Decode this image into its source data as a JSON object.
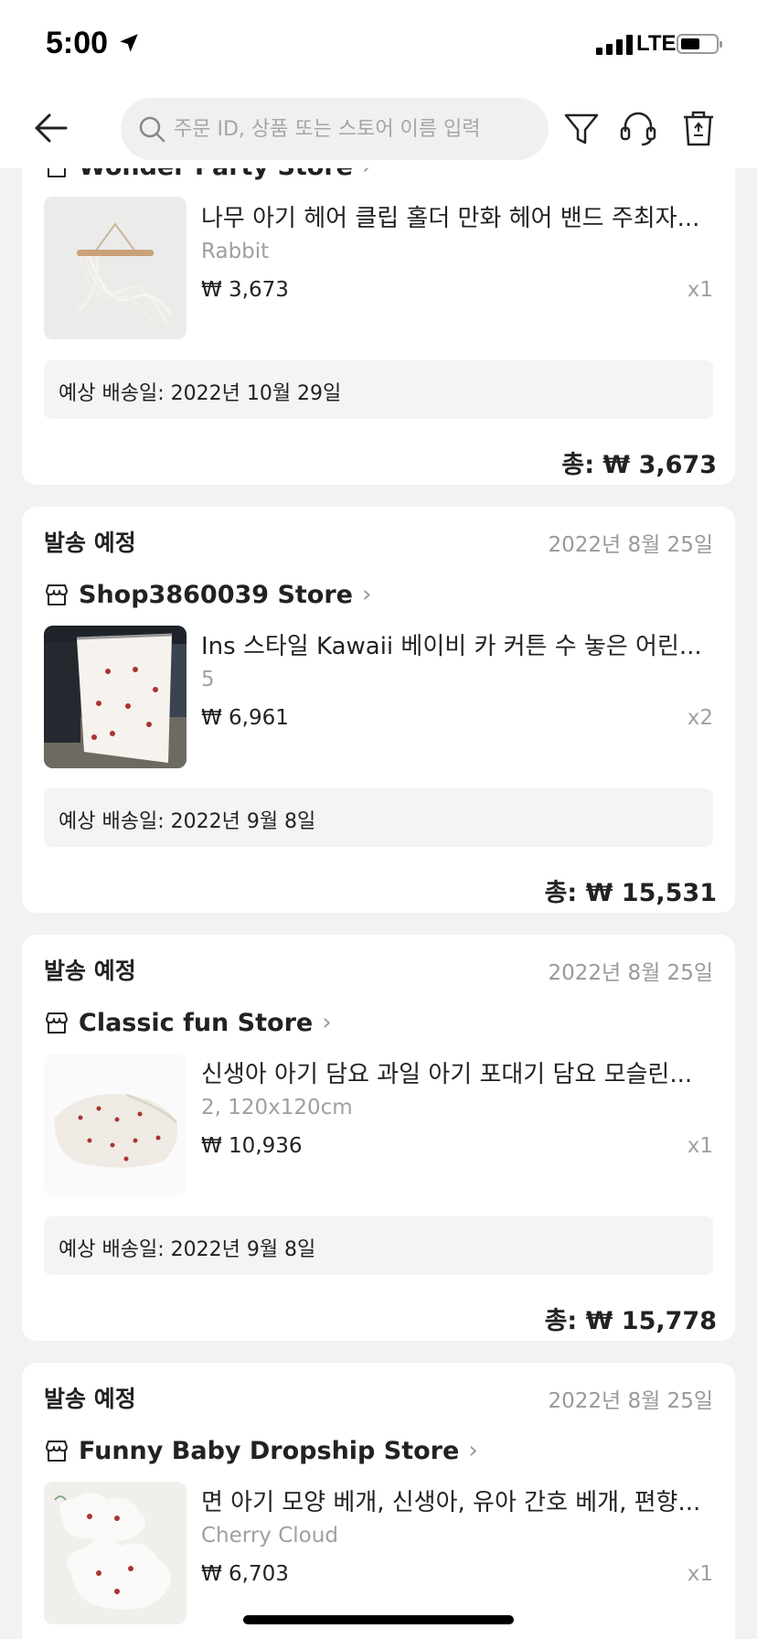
{
  "status_bar": {
    "time": "5:00",
    "network": "LTE"
  },
  "search": {
    "placeholder": "주문 ID, 상품 또는 스토어 이름 입력"
  },
  "orders": [
    {
      "store": "Wonder Party Store",
      "product_title": "나무 아기 헤어 클립 홀더 만화 헤어 밴드 주최자...",
      "variant": "Rabbit",
      "price": "₩ 3,673",
      "quantity": "x1",
      "eta": "예상 배송일: 2022년 10월 29일",
      "total": "총: ₩ 3,673"
    },
    {
      "status": "발송 예정",
      "date": "2022년 8월 25일",
      "store": "Shop3860039 Store",
      "product_title": "Ins 스타일 Kawaii 베이비 카 커튼 수 놓은 어린...",
      "variant": "5",
      "price": "₩ 6,961",
      "quantity": "x2",
      "eta": "예상 배송일: 2022년 9월 8일",
      "total": "총: ₩ 15,531"
    },
    {
      "status": "발송 예정",
      "date": "2022년 8월 25일",
      "store": "Classic fun Store",
      "product_title": "신생아 아기 담요 과일 아기 포대기 담요 모슬린...",
      "variant": "2, 120x120cm",
      "price": "₩ 10,936",
      "quantity": "x1",
      "eta": "예상 배송일: 2022년 9월 8일",
      "total": "총: ₩ 15,778"
    },
    {
      "status": "발송 예정",
      "date": "2022년 8월 25일",
      "store": "Funny Baby Dropship Store",
      "product_title": "면 아기 모양 베개, 신생아, 유아 간호 베개, 편향...",
      "variant": "Cherry Cloud",
      "price": "₩ 6,703",
      "quantity": "x1"
    }
  ]
}
